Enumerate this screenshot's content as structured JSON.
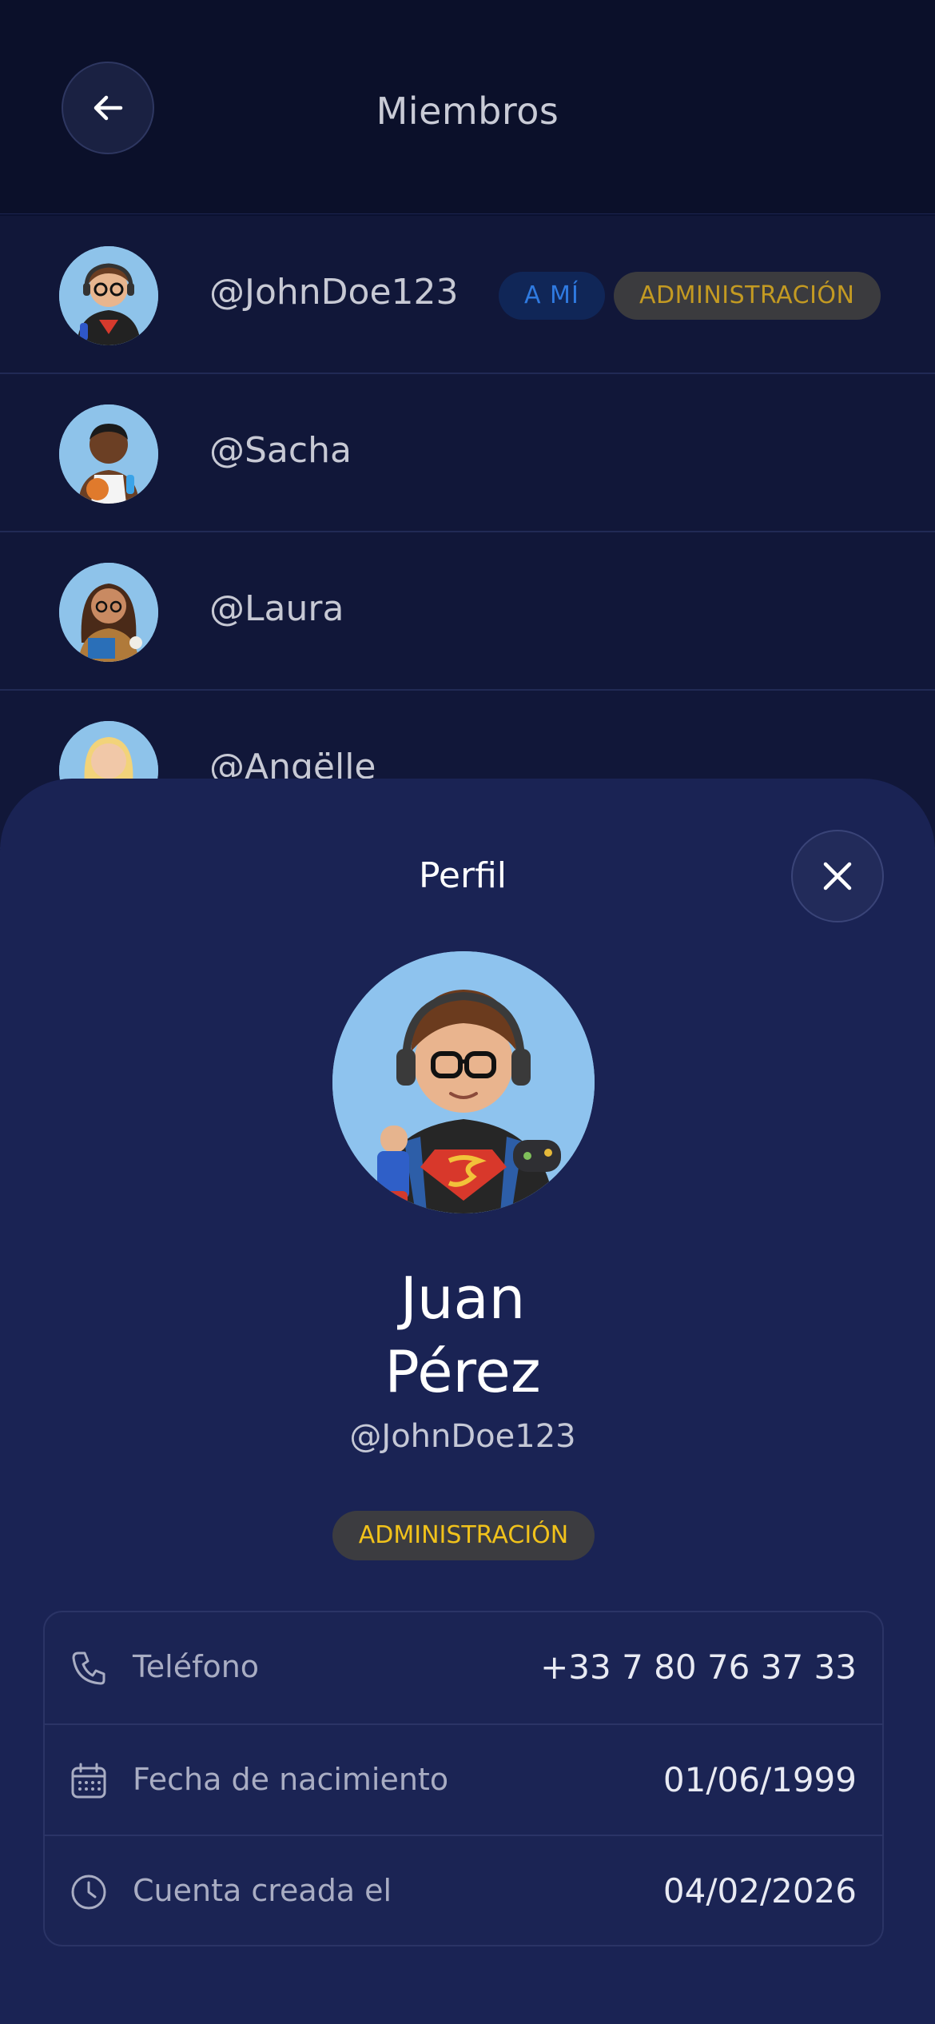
{
  "header": {
    "title": "Miembros",
    "back_icon": "arrow-left-icon"
  },
  "members": [
    {
      "handle": "@JohnDoe123",
      "avatar": "avatar-glasses-headphones",
      "badges": {
        "me": "A MÍ",
        "admin": "ADMINISTRACIÓN"
      }
    },
    {
      "handle": "@Sacha",
      "avatar": "avatar-basketball"
    },
    {
      "handle": "@Laura",
      "avatar": "avatar-reader"
    },
    {
      "handle": "@Angëlle",
      "avatar": "avatar-blonde"
    }
  ],
  "profile_sheet": {
    "title": "Perfil",
    "close_icon": "close-icon",
    "name_line1": "Juan",
    "name_line2": "Pérez",
    "handle": "@JohnDoe123",
    "role_badge": "ADMINISTRACIÓN",
    "details": [
      {
        "icon": "phone-icon",
        "label": "Teléfono",
        "value": "+33 7 80 76 37 33"
      },
      {
        "icon": "calendar-icon",
        "label": "Fecha de nacimiento",
        "value": "01/06/1999"
      },
      {
        "icon": "clock-icon",
        "label": "Cuenta creada el",
        "value": "04/02/2026"
      }
    ]
  },
  "colors": {
    "background": "#0b1130",
    "sheet": "#1a2354",
    "admin_text": "#f1c21b",
    "me_badge_text": "#2f7ae0"
  }
}
